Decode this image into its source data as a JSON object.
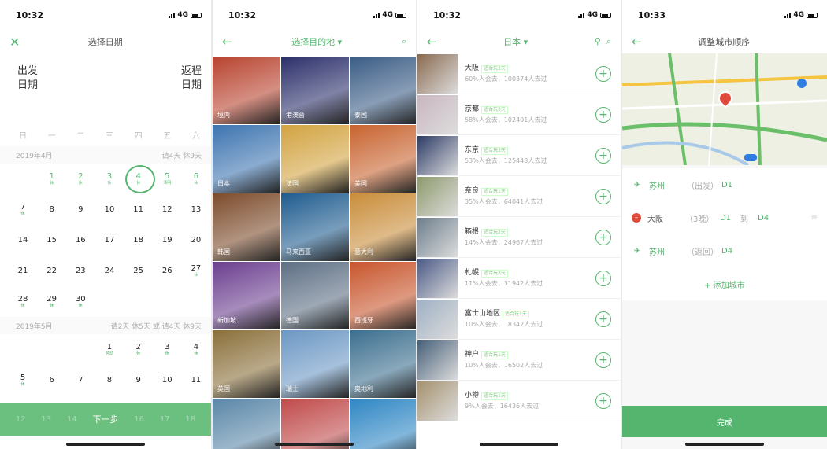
{
  "screen1": {
    "time": "10:32",
    "network": "4G",
    "close_icon": "close-icon",
    "title": "选择日期",
    "departure": "出发\n日期",
    "return": "返程\n日期",
    "weekdays": [
      "日",
      "一",
      "二",
      "三",
      "四",
      "五",
      "六"
    ],
    "april": {
      "label": "2019年4月",
      "note": "请4天 休9天"
    },
    "may": {
      "label": "2019年5月",
      "note": "请2天 休5天 或 请4天 休9天"
    },
    "rows": [
      [
        [
          "",
          ""
        ],
        [
          "1",
          "休"
        ],
        [
          "2",
          "休"
        ],
        [
          "3",
          "休"
        ],
        [
          "4",
          "休"
        ],
        [
          "5",
          "清明"
        ],
        [
          "6",
          "休"
        ]
      ],
      [
        [
          "7",
          "休"
        ],
        [
          "8",
          ""
        ],
        [
          "9",
          ""
        ],
        [
          "10",
          ""
        ],
        [
          "11",
          ""
        ],
        [
          "12",
          ""
        ],
        [
          "13",
          ""
        ]
      ],
      [
        [
          "14",
          ""
        ],
        [
          "15",
          ""
        ],
        [
          "16",
          ""
        ],
        [
          "17",
          ""
        ],
        [
          "18",
          ""
        ],
        [
          "19",
          ""
        ],
        [
          "20",
          ""
        ]
      ],
      [
        [
          "21",
          ""
        ],
        [
          "22",
          ""
        ],
        [
          "23",
          ""
        ],
        [
          "24",
          ""
        ],
        [
          "25",
          ""
        ],
        [
          "26",
          ""
        ],
        [
          "27",
          "休"
        ]
      ],
      [
        [
          "28",
          "休"
        ],
        [
          "29",
          "休"
        ],
        [
          "30",
          "休"
        ],
        [
          "",
          ""
        ],
        [
          "",
          ""
        ],
        [
          "",
          ""
        ],
        [
          "",
          ""
        ]
      ]
    ],
    "may_rows": [
      [
        [
          "",
          ""
        ],
        [
          "",
          ""
        ],
        [
          "",
          ""
        ],
        [
          "1",
          "劳动"
        ],
        [
          "2",
          "休"
        ],
        [
          "3",
          "休"
        ],
        [
          "4",
          "休"
        ]
      ],
      [
        [
          "5",
          "休"
        ],
        [
          "6",
          ""
        ],
        [
          "7",
          ""
        ],
        [
          "8",
          ""
        ],
        [
          "9",
          ""
        ],
        [
          "10",
          ""
        ],
        [
          "11",
          ""
        ]
      ]
    ],
    "next_bar": [
      "12",
      "13",
      "14",
      "下一步",
      "16",
      "17",
      "18"
    ]
  },
  "screen2": {
    "time": "10:32",
    "title": "选择目的地 ▾",
    "cells": [
      "境内",
      "港澳台",
      "泰国",
      "日本",
      "法国",
      "美国",
      "韩国",
      "马来西亚",
      "意大利",
      "新加坡",
      "德国",
      "西班牙",
      "英国",
      "瑞士",
      "奥地利",
      "",
      "",
      ""
    ],
    "colors": [
      "#b8432f",
      "#2b2f6a",
      "#3a5c85",
      "#3d74b0",
      "#d2a340",
      "#c8632f",
      "#7c4b2b",
      "#1f5c8f",
      "#c98d3a",
      "#6b3e8f",
      "#5d6f84",
      "#c8552c",
      "#8a6f3a",
      "#6b97c4",
      "#3b6e8e",
      "#5a87a8",
      "#c04a4a",
      "#2e86c4"
    ]
  },
  "screen3": {
    "time": "10:32",
    "title": "日本 ▾",
    "items": [
      {
        "name": "大阪",
        "tag": "适合玩3天",
        "stat": "60%人会去，100374人去过",
        "color": "#8a6a50"
      },
      {
        "name": "京都",
        "tag": "适合玩3天",
        "stat": "58%人会去，102401人去过",
        "color": "#c9b6c0"
      },
      {
        "name": "东京",
        "tag": "适合玩3天",
        "stat": "53%人会去，125443人去过",
        "color": "#2c3b66"
      },
      {
        "name": "奈良",
        "tag": "适合玩1天",
        "stat": "35%人会去，64041人去过",
        "color": "#8d9a6b"
      },
      {
        "name": "箱根",
        "tag": "适合玩2天",
        "stat": "14%人会去，24967人去过",
        "color": "#6d7e8c"
      },
      {
        "name": "札幌",
        "tag": "适合玩3天",
        "stat": "11%人会去，31942人去过",
        "color": "#4b5a86"
      },
      {
        "name": "富士山地区",
        "tag": "适合玩1天",
        "stat": "10%人会去，18342人去过",
        "color": "#9fb0c4"
      },
      {
        "name": "神户",
        "tag": "适合玩1天",
        "stat": "10%人会去，16502人去过",
        "color": "#476078"
      },
      {
        "name": "小樽",
        "tag": "适合玩1天",
        "stat": "9%人会去，16436人去过",
        "color": "#a5926e"
      }
    ]
  },
  "screen4": {
    "time": "10:33",
    "title": "调整城市顺序",
    "rows": [
      {
        "city": "苏州",
        "role": "（出发）",
        "d1": "D1",
        "to": "",
        "d2": ""
      },
      {
        "city": "大阪",
        "role": "（3晚）",
        "d1": "D1",
        "to": "到",
        "d2": "D4"
      },
      {
        "city": "苏州",
        "role": "（返回）",
        "d1": "D4",
        "to": "",
        "d2": ""
      }
    ],
    "add": "+ 添加城市",
    "done": "完成"
  }
}
